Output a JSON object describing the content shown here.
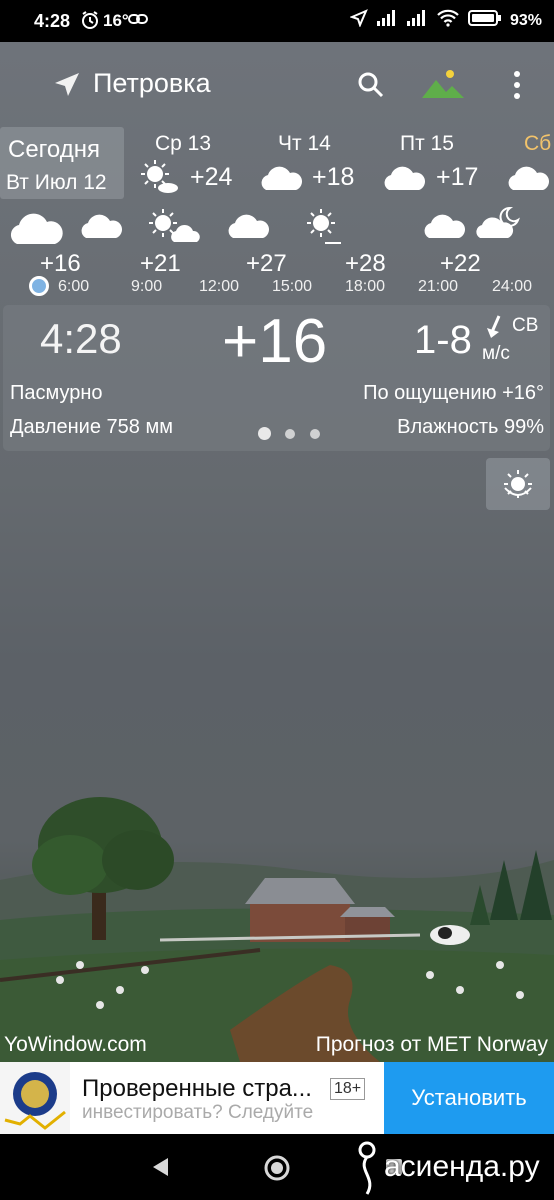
{
  "status_bar": {
    "time": "4:28",
    "temp": "16°",
    "battery": "93%"
  },
  "header": {
    "location": "Петровка"
  },
  "days": {
    "today_label": "Сегодня",
    "today_date": "Вт Июл 12",
    "items": [
      {
        "name": "Ср 13",
        "temp": "+24"
      },
      {
        "name": "Чт 14",
        "temp": "+18"
      },
      {
        "name": "Пт 15",
        "temp": "+17"
      },
      {
        "name": "Сб",
        "temp": ""
      }
    ]
  },
  "hourly": [
    {
      "temp": "+16",
      "time": "6:00"
    },
    {
      "temp": "+21",
      "time": "9:00"
    },
    {
      "temp": "",
      "time": "12:00"
    },
    {
      "temp": "+27",
      "time": "15:00"
    },
    {
      "temp": "+28",
      "time": "18:00"
    },
    {
      "temp": "+22",
      "time": "21:00"
    },
    {
      "temp": "",
      "time": "24:00"
    }
  ],
  "current": {
    "time": "4:28",
    "temp": "+16",
    "wind_speed": "1-8",
    "wind_dir": "СВ",
    "wind_unit": "м/с",
    "condition": "Пасмурно",
    "feels_like": "По ощущению +16°",
    "pressure": "Давление 758 мм",
    "humidity": "Влажность 99%"
  },
  "credits": {
    "left": "YoWindow.com",
    "right": "Прогноз от MET Norway"
  },
  "ad": {
    "title": "Проверенные стра...",
    "age": "18+",
    "subtitle": "инвестировать? Следуйте",
    "install": "Установить"
  },
  "watermark": "асиенда.ру",
  "colors": {
    "sky": "#676c72",
    "panel": "#7a7f86",
    "install_button": "#1e9bf0",
    "saturday": "#f2c36b",
    "now_dot": "#7fb3e3"
  }
}
